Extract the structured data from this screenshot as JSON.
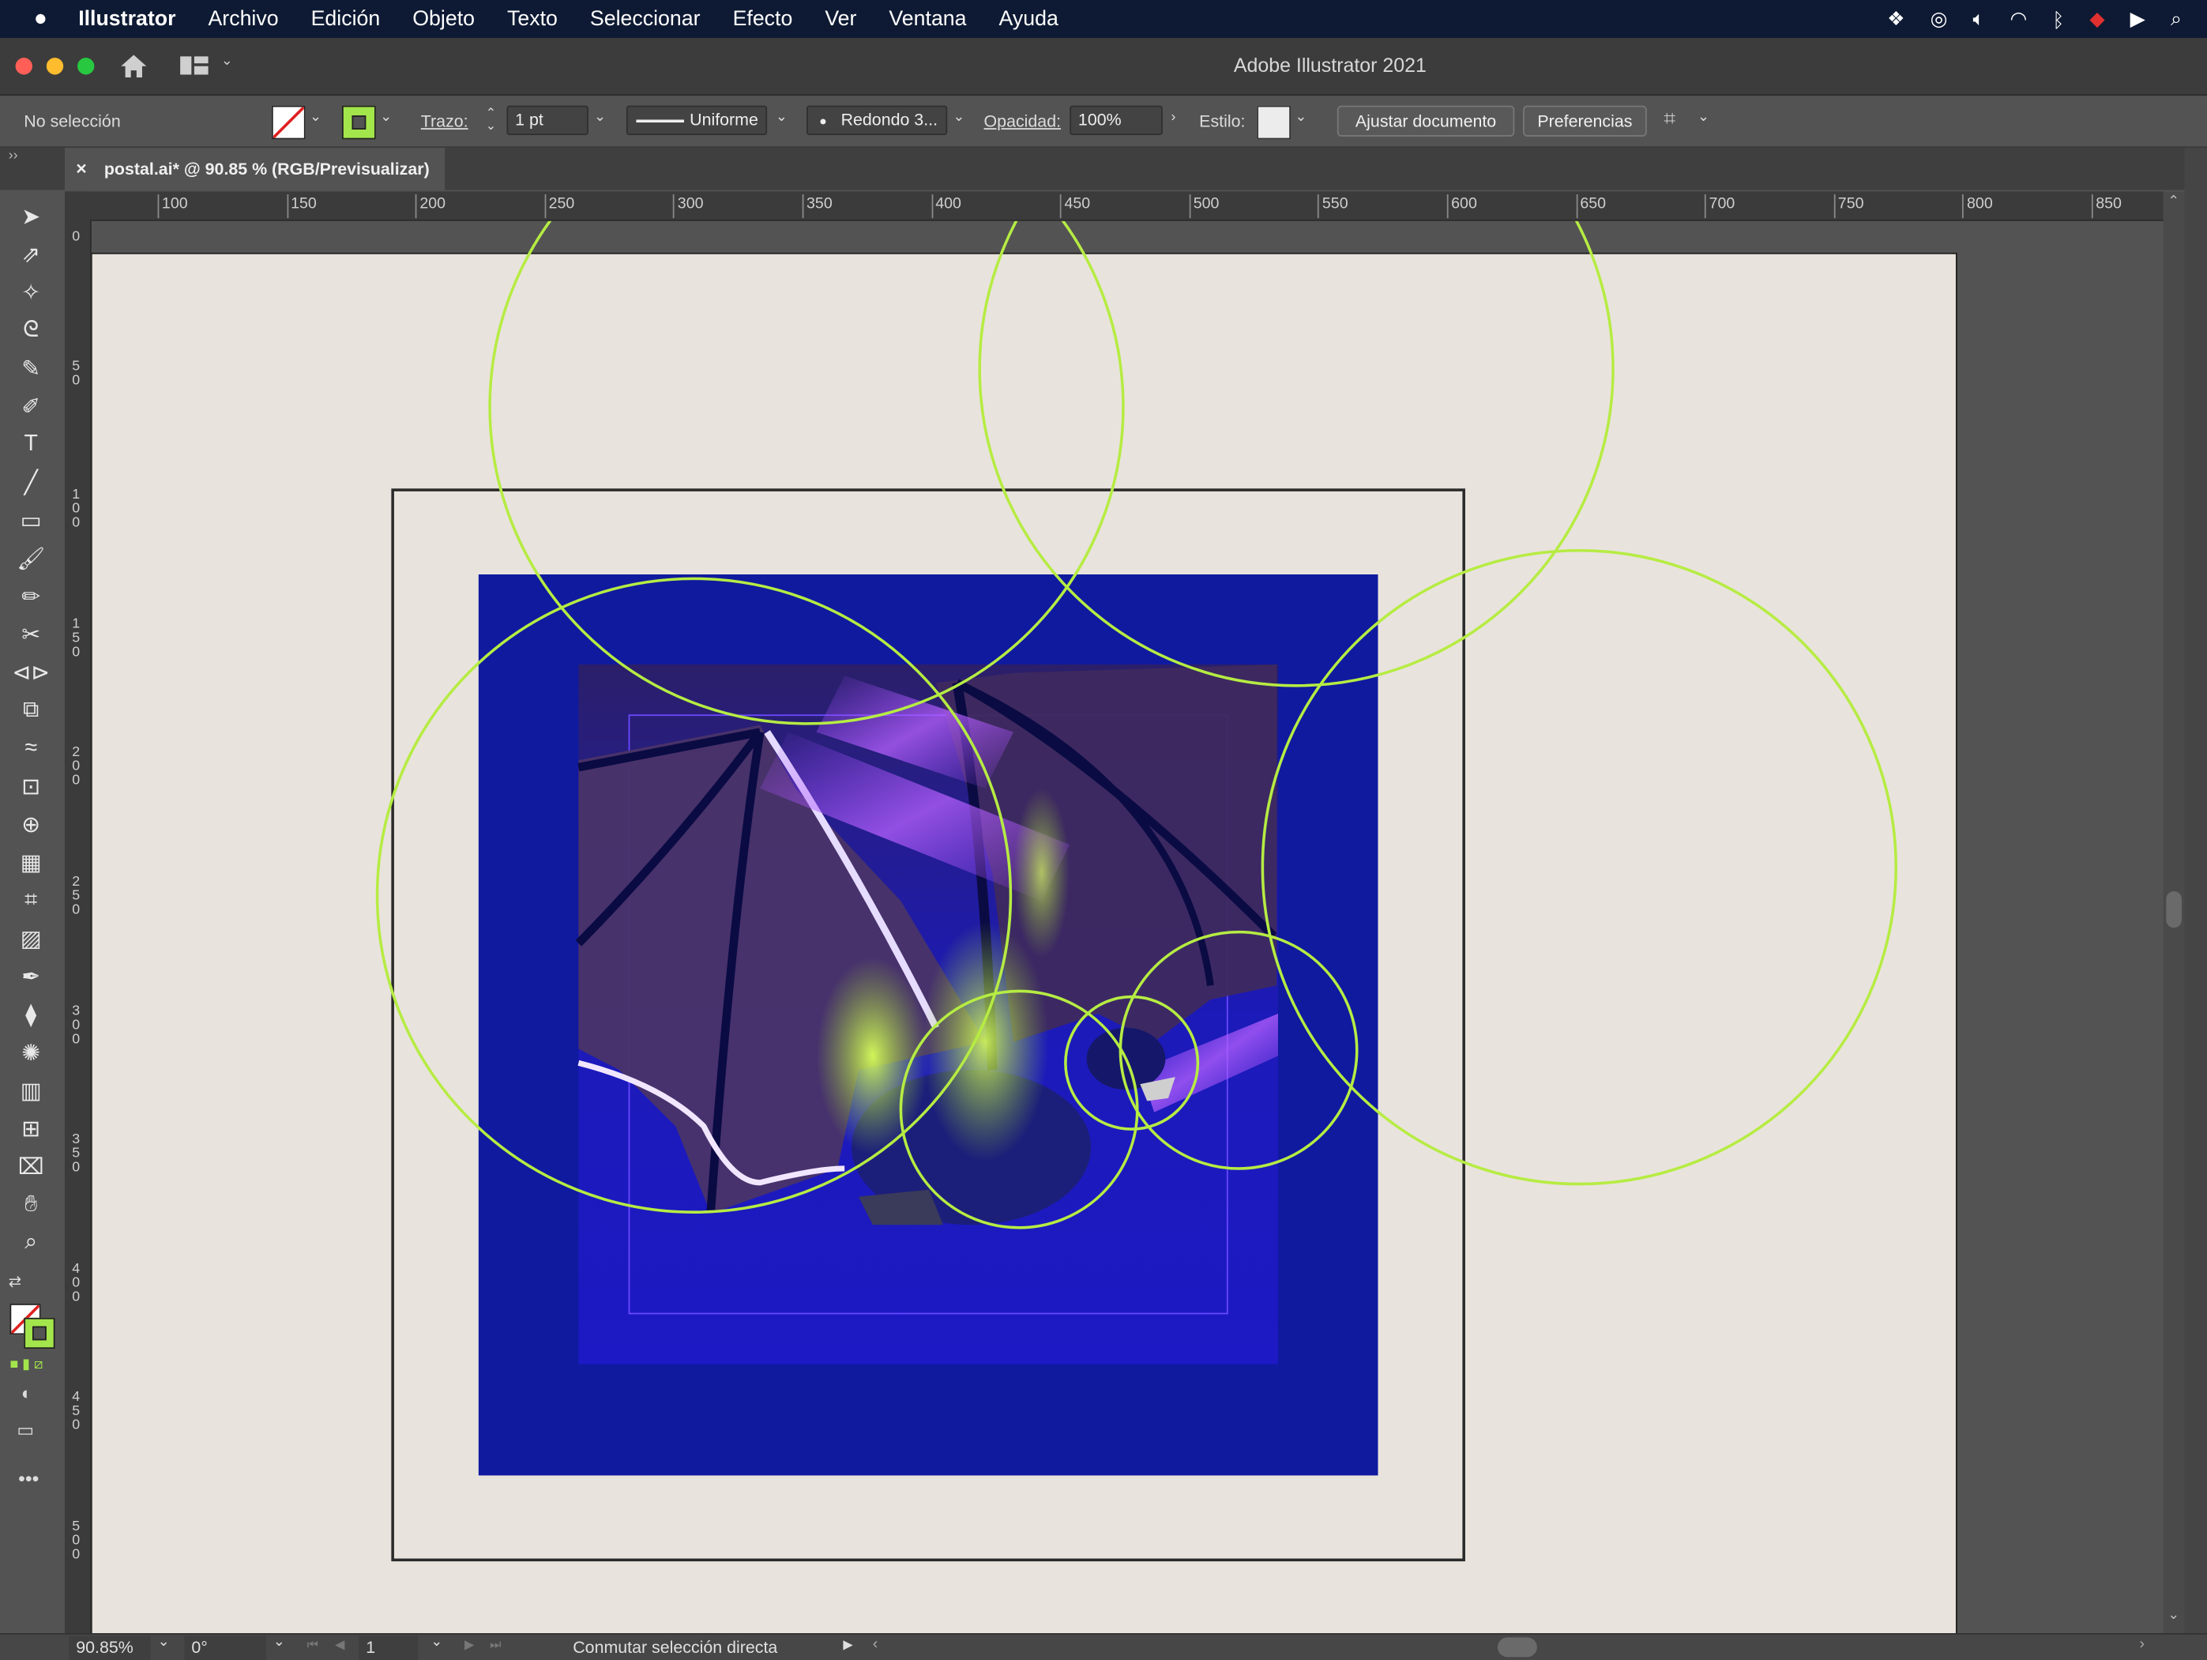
{
  "menubar": {
    "app_name": "Illustrator",
    "items": [
      "Archivo",
      "Edición",
      "Objeto",
      "Texto",
      "Seleccionar",
      "Efecto",
      "Ver",
      "Ventana",
      "Ayuda"
    ]
  },
  "window": {
    "title": "Adobe Illustrator 2021"
  },
  "control_bar": {
    "selection_status": "No selección",
    "stroke_label": "Trazo:",
    "stroke_weight": "1 pt",
    "stroke_profile": "Uniforme",
    "brush": "Redondo 3...",
    "opacity_label": "Opacidad:",
    "opacity_value": "100%",
    "style_label": "Estilo:",
    "fit_document_button": "Ajustar documento",
    "preferences_button": "Preferencias"
  },
  "document_tab": {
    "title": "postal.ai* @ 90.85 % (RGB/Previsualizar)",
    "close": "×"
  },
  "rulers": {
    "horizontal": [
      "100",
      "150",
      "200",
      "250",
      "300",
      "350",
      "400",
      "450",
      "500",
      "550",
      "600",
      "650",
      "700",
      "750",
      "800",
      "850"
    ],
    "vertical": [
      "0",
      "50",
      "100",
      "150",
      "200",
      "250",
      "300",
      "350",
      "400",
      "450",
      "500"
    ]
  },
  "status_bar": {
    "zoom": "90.85%",
    "rotation": "0°",
    "artboard_number": "1",
    "tool_hint": "Conmutar selección directa"
  },
  "colors": {
    "guide_circle": "#b6ec43",
    "artboard_bg": "#e9e3dd",
    "poster_blue": "#0f1a9e",
    "wing_purple": "#3e2a63",
    "fill_swatch": "none",
    "stroke_swatch": "#a3e64b"
  },
  "tools": [
    "selection-tool-icon",
    "direct-selection-tool-icon",
    "magic-wand-icon",
    "lasso-icon",
    "pen-icon",
    "curvature-icon",
    "type-icon",
    "line-icon",
    "rectangle-icon",
    "paintbrush-icon",
    "shaper-icon",
    "scissors-icon",
    "reflect-icon",
    "scale-icon",
    "warp-icon",
    "free-transform-icon",
    "shape-builder-icon",
    "perspective-grid-icon",
    "mesh-icon",
    "gradient-icon",
    "eyedropper-icon",
    "blend-icon",
    "symbol-sprayer-icon",
    "column-graph-icon",
    "artboard-icon",
    "slice-icon",
    "hand-icon",
    "zoom-icon"
  ]
}
